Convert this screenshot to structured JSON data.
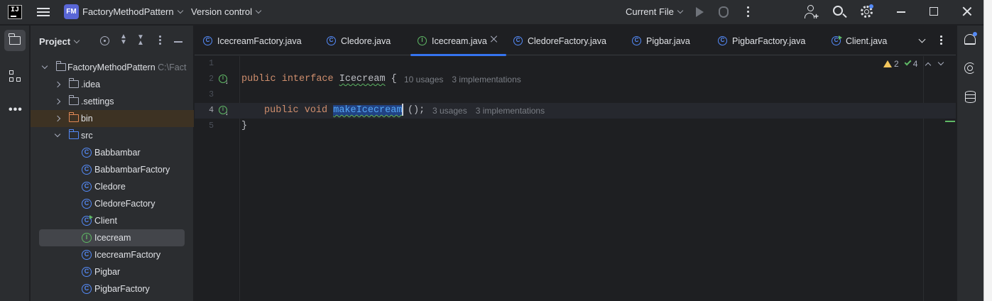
{
  "titlebar": {
    "logo_text": "IJ",
    "project_badge": "FM",
    "project_name": "FactoryMethodPattern",
    "version_control": "Version control",
    "run_config": "Current File"
  },
  "project_panel": {
    "title": "Project",
    "root": {
      "label": "FactoryMethodPattern",
      "path": "C:\\Fact"
    },
    "folders": [
      {
        "label": ".idea"
      },
      {
        "label": ".settings"
      },
      {
        "label": "bin"
      },
      {
        "label": "src"
      }
    ],
    "files": [
      {
        "label": "Babbambar",
        "badge": "C"
      },
      {
        "label": "BabbambarFactory",
        "badge": "C"
      },
      {
        "label": "Cledore",
        "badge": "C"
      },
      {
        "label": "CledoreFactory",
        "badge": "C"
      },
      {
        "label": "Client",
        "badge": "C"
      },
      {
        "label": "Icecream",
        "badge": "I"
      },
      {
        "label": "IcecreamFactory",
        "badge": "C"
      },
      {
        "label": "Pigbar",
        "badge": "C"
      },
      {
        "label": "PigbarFactory",
        "badge": "C"
      }
    ]
  },
  "tabs": [
    {
      "label": "IcecreamFactory.java",
      "badge": "C"
    },
    {
      "label": "Cledore.java",
      "badge": "C"
    },
    {
      "label": "Icecream.java",
      "badge": "I"
    },
    {
      "label": "CledoreFactory.java",
      "badge": "C"
    },
    {
      "label": "Pigbar.java",
      "badge": "C"
    },
    {
      "label": "PigbarFactory.java",
      "badge": "C"
    },
    {
      "label": "Client.java",
      "badge": "C"
    }
  ],
  "editor": {
    "line_numbers": [
      "1",
      "2",
      "3",
      "4",
      "5"
    ],
    "gutter_badge": "I",
    "gutter_arrow": "↓",
    "line2": {
      "kw1": "public",
      "kw2": "interface",
      "name": "Icecream",
      "brace": " {",
      "usages": "10 usages",
      "impls": "3 implementations"
    },
    "line4": {
      "kw1": "public",
      "kw2": "void",
      "name": "makeIcecream",
      "rest": "();",
      "usages": "3 usages",
      "impls": "3 implementations"
    },
    "line5": "}",
    "inspections": {
      "warnings": "2",
      "ok": "4"
    }
  },
  "colors": {
    "accent": "#3574f0",
    "class_icon": "#548af7",
    "interface_icon": "#5fb865",
    "keyword": "#cf8e6d",
    "warning": "#f2c55c"
  }
}
